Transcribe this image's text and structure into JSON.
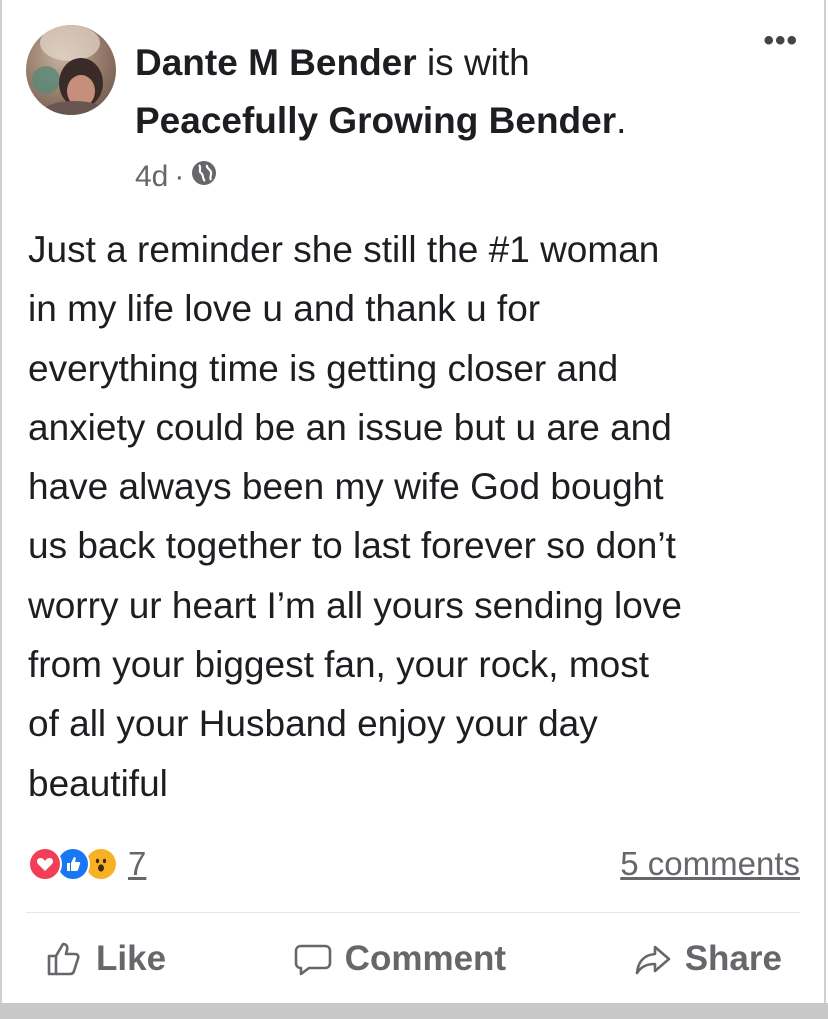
{
  "post": {
    "author": "Dante M Bender",
    "with_text": "is with",
    "tagged": "Peacefully Growing Bender",
    "tagged_suffix": ".",
    "time": "4d",
    "separator": "·",
    "audience_icon": "globe-icon",
    "more_icon": "more-options-icon",
    "more_label": "•••",
    "body": "Just a reminder she still the #1 woman\nin my life love u and thank u for\neverything time is getting closer and\nanxiety could be an issue but u are and\nhave always been my wife God bought\nus back together to last forever so don’t\nworry ur heart I’m all yours sending love\nfrom your biggest fan, your rock, most\nof all your Husband enjoy your day\nbeautiful"
  },
  "stats": {
    "reactions": [
      "love-reaction-icon",
      "like-reaction-icon",
      "wow-reaction-icon"
    ],
    "reaction_count": "7",
    "comments": "5 comments"
  },
  "actions": {
    "like_label": "Like",
    "comment_label": "Comment",
    "share_label": "Share"
  },
  "colors": {
    "text": "#1c1e21",
    "secondary": "#65676b",
    "love": "#f33e58",
    "like": "#1877f2",
    "wow": "#f7b125"
  }
}
